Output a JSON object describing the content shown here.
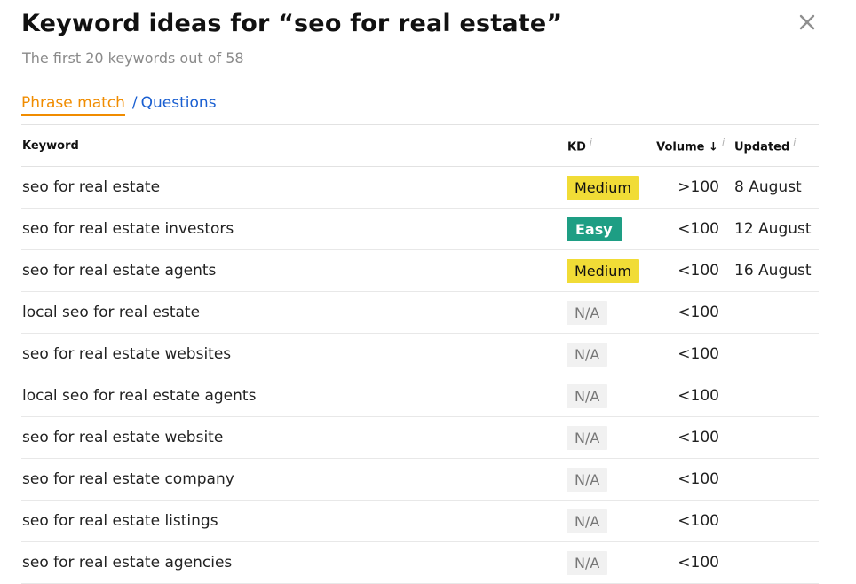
{
  "header": {
    "title": "Keyword ideas for “seo for real estate”",
    "subtitle": "The first 20 keywords out of 58",
    "close_icon": "close-icon"
  },
  "tabs": [
    {
      "label": "Phrase match",
      "active": true
    },
    {
      "label": "Questions",
      "active": false
    }
  ],
  "tab_separator": "/",
  "table": {
    "columns": {
      "keyword": "Keyword",
      "kd": "KD",
      "volume": "Volume",
      "volume_sort": "↓",
      "updated": "Updated",
      "info": "i"
    },
    "rows": [
      {
        "keyword": "seo for real estate",
        "kd": "Medium",
        "volume": ">100",
        "updated": "8 August"
      },
      {
        "keyword": "seo for real estate investors",
        "kd": "Easy",
        "volume": "<100",
        "updated": "12 August"
      },
      {
        "keyword": "seo for real estate agents",
        "kd": "Medium",
        "volume": "<100",
        "updated": "16 August"
      },
      {
        "keyword": "local seo for real estate",
        "kd": "N/A",
        "volume": "<100",
        "updated": ""
      },
      {
        "keyword": "seo for real estate websites",
        "kd": "N/A",
        "volume": "<100",
        "updated": ""
      },
      {
        "keyword": "local seo for real estate agents",
        "kd": "N/A",
        "volume": "<100",
        "updated": ""
      },
      {
        "keyword": "seo for real estate website",
        "kd": "N/A",
        "volume": "<100",
        "updated": ""
      },
      {
        "keyword": "seo for real estate company",
        "kd": "N/A",
        "volume": "<100",
        "updated": ""
      },
      {
        "keyword": "seo for real estate listings",
        "kd": "N/A",
        "volume": "<100",
        "updated": ""
      },
      {
        "keyword": "seo for real estate agencies",
        "kd": "N/A",
        "volume": "<100",
        "updated": ""
      }
    ]
  },
  "colors": {
    "active_tab": "#f08c00",
    "link": "#1a5fd1",
    "kd_medium": "#f1dc36",
    "kd_easy": "#1e9e84",
    "kd_na": "#f1f1f1"
  }
}
